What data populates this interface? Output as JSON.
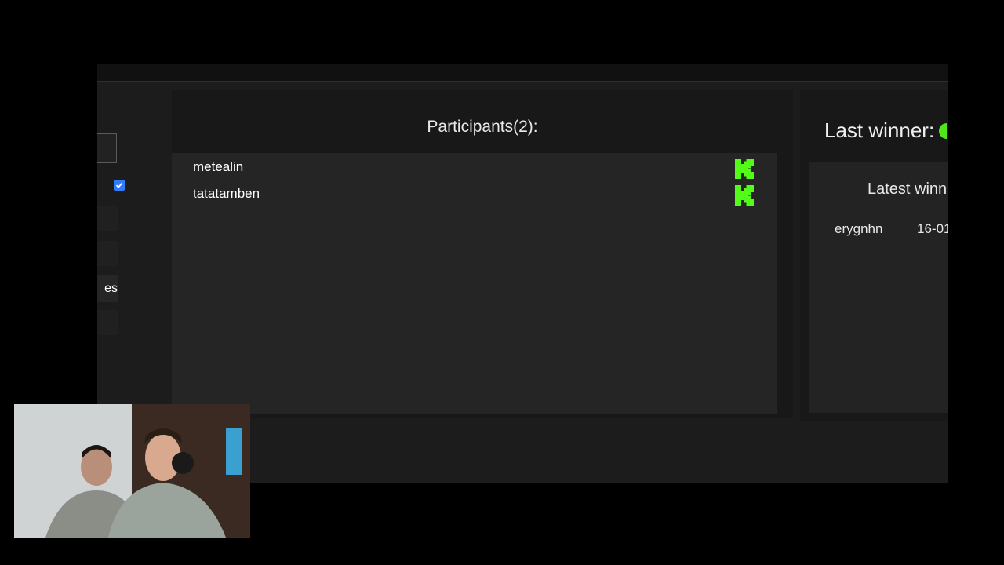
{
  "participants": {
    "title": "Participants(2):",
    "items": [
      {
        "name": "metealin",
        "platform_icon": "kick-icon"
      },
      {
        "name": "tatatamben",
        "platform_icon": "kick-icon"
      }
    ]
  },
  "left_controls": {
    "partial_label": "es"
  },
  "winner": {
    "title": "Last winner:",
    "latest_title": "Latest winn",
    "latest_entries": [
      {
        "name": "erygnhn",
        "date": "16-01"
      }
    ]
  },
  "colors": {
    "kick_green": "#53fc18",
    "checkbox_blue": "#2f7bff",
    "panel_bg": "#181818",
    "list_bg": "#252525"
  },
  "webcam": {
    "label": "webcam-overlay"
  }
}
